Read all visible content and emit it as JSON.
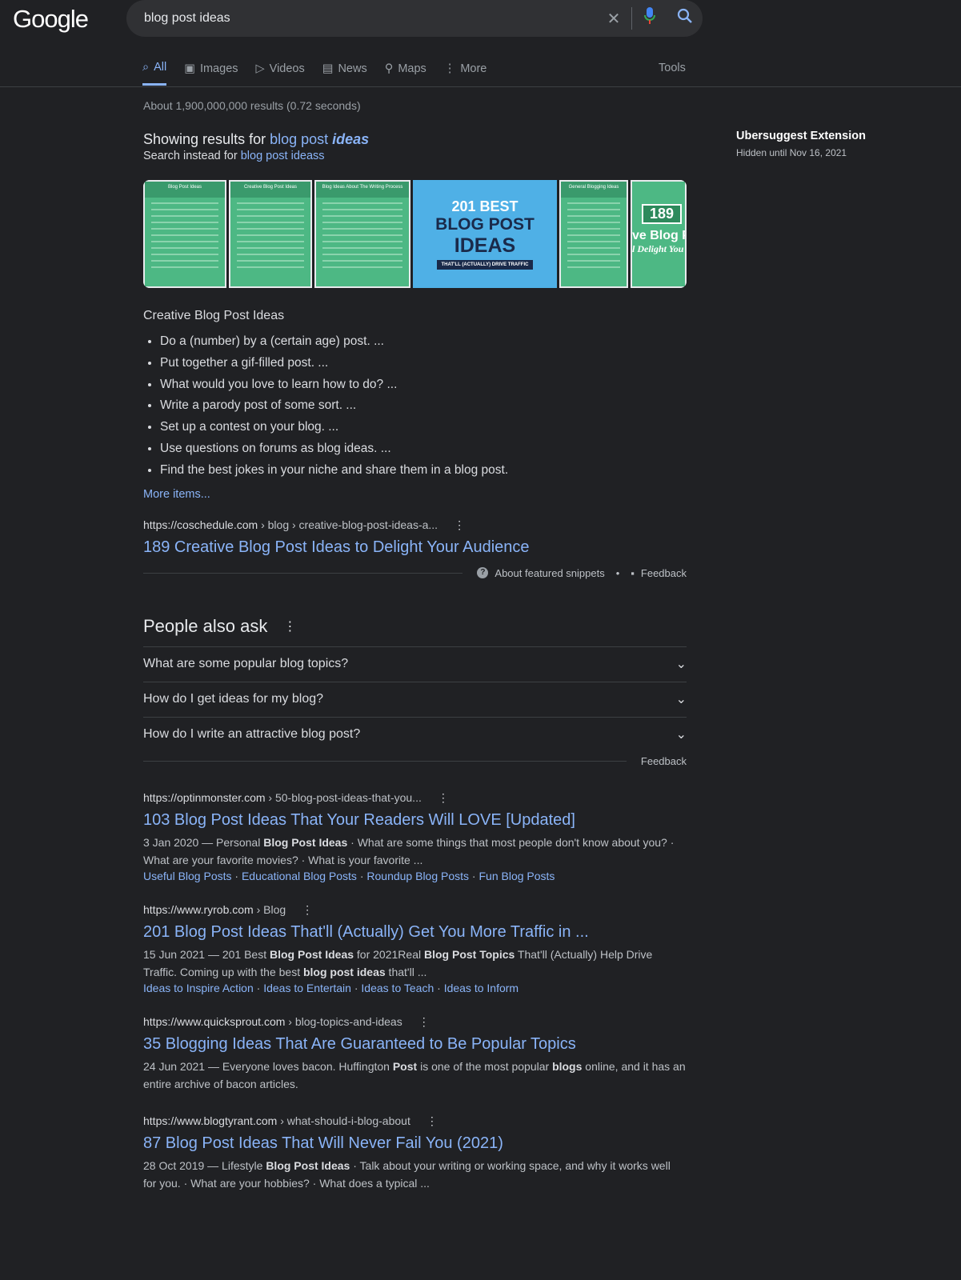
{
  "logo": "Google",
  "search": {
    "value": "blog post ideas"
  },
  "tabs": [
    {
      "label": "All",
      "icon": "search-icon"
    },
    {
      "label": "Images",
      "icon": "image-icon"
    },
    {
      "label": "Videos",
      "icon": "play-icon"
    },
    {
      "label": "News",
      "icon": "news-icon"
    },
    {
      "label": "Maps",
      "icon": "pin-icon"
    },
    {
      "label": "More",
      "icon": "dots-icon"
    }
  ],
  "tools": "Tools",
  "stats": "About 1,900,000,000 results (0.72 seconds)",
  "correction": {
    "prefix": "Showing results for ",
    "q1": "blog post ",
    "q2": "ideas",
    "instead_prefix": "Search instead for ",
    "instead": "blog post ideass"
  },
  "images": [
    {
      "title": "Blog Post Ideas"
    },
    {
      "title": "Creative Blog Post Ideas"
    },
    {
      "title": "Blog Ideas About The Writing Process"
    },
    {
      "line1": "201 BEST",
      "line2": "BLOG POST",
      "line3": "IDEAS",
      "line4": "THAT'LL (ACTUALLY) DRIVE TRAFFIC"
    },
    {
      "title": "General Blogging Ideas"
    },
    {
      "num": "189",
      "text": "ve Blog Po",
      "sub": "l Delight You"
    }
  ],
  "snippet": {
    "heading": "Creative Blog Post Ideas",
    "items": [
      "Do a (number) by a (certain age) post. ...",
      "Put together a gif-filled post. ...",
      "What would you love to learn how to do? ...",
      "Write a parody post of some sort. ...",
      "Set up a contest on your blog. ...",
      "Use questions on forums as blog ideas. ...",
      "Find the best jokes in your niche and share them in a blog post."
    ],
    "more": "More items...",
    "site": "https://coschedule.com",
    "path": "› blog › creative-blog-post-ideas-a...",
    "title": "189 Creative Blog Post Ideas to Delight Your Audience",
    "about": "About featured snippets",
    "feedback": "Feedback"
  },
  "paa": {
    "heading": "People also ask",
    "questions": [
      "What are some popular blog topics?",
      "How do I get ideas for my blog?",
      "How do I write an attractive blog post?"
    ],
    "feedback": "Feedback"
  },
  "results": [
    {
      "site": "https://optinmonster.com",
      "path": "› 50-blog-post-ideas-that-you...",
      "title": "103 Blog Post Ideas That Your Readers Will LOVE [Updated]",
      "desc": [
        "3 Jan 2020 — Personal ",
        "Blog Post Ideas",
        " · What are some things that most people don't know about you? · What are your favorite movies? · What is your favorite ..."
      ],
      "sitelinks": [
        "Useful Blog Posts",
        "Educational Blog Posts",
        "Roundup Blog Posts",
        "Fun Blog Posts"
      ]
    },
    {
      "site": "https://www.ryrob.com",
      "path": "› Blog",
      "title": "201 Blog Post Ideas That'll (Actually) Get You More Traffic in ...",
      "desc": [
        "15 Jun 2021 — 201 Best ",
        "Blog Post Ideas",
        " for 2021Real ",
        "Blog Post Topics",
        " That'll (Actually) Help Drive Traffic. Coming up with the best ",
        "blog post ideas",
        " that'll ..."
      ],
      "sitelinks": [
        "Ideas to Inspire Action",
        "Ideas to Entertain",
        "Ideas to Teach",
        "Ideas to Inform"
      ]
    },
    {
      "site": "https://www.quicksprout.com",
      "path": "› blog-topics-and-ideas",
      "title": "35 Blogging Ideas That Are Guaranteed to Be Popular Topics",
      "desc": [
        "24 Jun 2021 — Everyone loves bacon. Huffington ",
        "Post",
        " is one of the most popular ",
        "blogs",
        " online, and it has an entire archive of bacon articles."
      ],
      "sitelinks": []
    },
    {
      "site": "https://www.blogtyrant.com",
      "path": "› what-should-i-blog-about",
      "title": "87 Blog Post Ideas That Will Never Fail You (2021)",
      "desc": [
        "28 Oct 2019 — Lifestyle ",
        "Blog Post Ideas",
        " · Talk about your writing or working space, and why it works well for you. · What are your hobbies? · What does a typical ..."
      ],
      "sitelinks": []
    }
  ],
  "sidebar": {
    "title": "Ubersuggest Extension",
    "sub": "Hidden until Nov 16, 2021"
  },
  "colors": {
    "bg": "#202124",
    "link": "#8ab4f8",
    "text": "#bdc1c6"
  }
}
